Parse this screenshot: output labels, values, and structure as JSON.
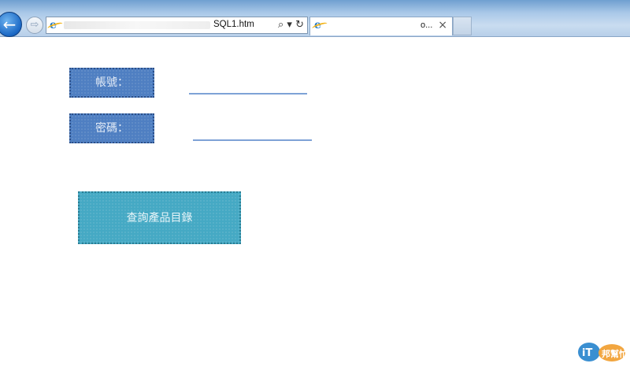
{
  "browser": {
    "address": {
      "url_suffix": "SQL1.htm"
    },
    "tab": {
      "title_suffix": "o...",
      "close_glyph": "×"
    },
    "icons": {
      "back": "←",
      "forward": "⇨",
      "search": "⌕",
      "dropdown": "▾",
      "refresh": "↻"
    }
  },
  "form": {
    "account_label": "帳號：",
    "password_label": "密碼：",
    "query_button_label": "查詢產品目錄"
  },
  "watermark": {
    "text": "iT邦幫忙"
  },
  "colors": {
    "label_bg": "#4f7fc2",
    "button_bg": "#45a9c4",
    "underline": "#7ea2d6"
  }
}
